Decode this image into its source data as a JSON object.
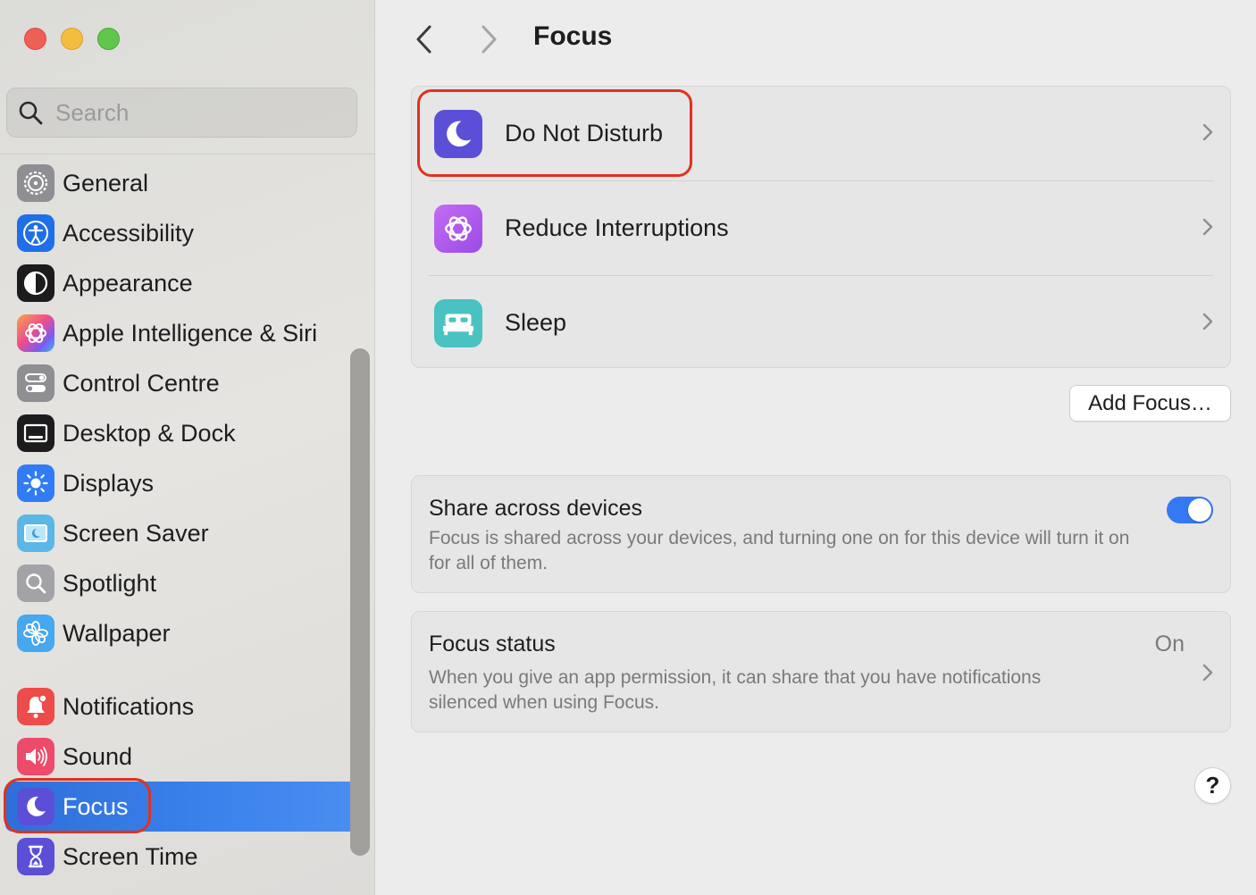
{
  "window": {
    "title": "Focus",
    "traffic_lights": [
      "close",
      "minimize",
      "maximize"
    ]
  },
  "sidebar": {
    "search": {
      "placeholder": "Search",
      "value": ""
    },
    "items": [
      {
        "label": "General",
        "icon": "gear-icon",
        "color": "#8e8e93"
      },
      {
        "label": "Accessibility",
        "icon": "accessibility-icon",
        "color": "#1f6fe8"
      },
      {
        "label": "Appearance",
        "icon": "appearance-icon",
        "color": "#1c1c1e"
      },
      {
        "label": "Apple Intelligence & Siri",
        "icon": "siri-icon",
        "color": "#f0f0f0"
      },
      {
        "label": "Control Centre",
        "icon": "control-centre-icon",
        "color": "#8e8e93"
      },
      {
        "label": "Desktop & Dock",
        "icon": "desktop-dock-icon",
        "color": "#1c1c1e"
      },
      {
        "label": "Displays",
        "icon": "displays-icon",
        "color": "#2f7cf6"
      },
      {
        "label": "Screen Saver",
        "icon": "screen-saver-icon",
        "color": "#5ab7e8"
      },
      {
        "label": "Spotlight",
        "icon": "spotlight-icon",
        "color": "#a2a2a7"
      },
      {
        "label": "Wallpaper",
        "icon": "wallpaper-icon",
        "color": "#47a7ef"
      },
      {
        "label": "Notifications",
        "icon": "notifications-icon",
        "color": "#ee4b4b"
      },
      {
        "label": "Sound",
        "icon": "sound-icon",
        "color": "#ee4b6a"
      },
      {
        "label": "Focus",
        "icon": "focus-moon-icon",
        "color": "#5b4fd8",
        "active": true
      },
      {
        "label": "Screen Time",
        "icon": "screen-time-icon",
        "color": "#5b4fd8"
      }
    ]
  },
  "main": {
    "title": "Focus",
    "focus_modes": [
      {
        "label": "Do Not Disturb",
        "icon": "moon-icon",
        "color": "#5b4fd8"
      },
      {
        "label": "Reduce Interruptions",
        "icon": "reduce-interruptions-icon",
        "color": "#b45bf0"
      },
      {
        "label": "Sleep",
        "icon": "bed-icon",
        "color": "#4ac2c2"
      }
    ],
    "add_focus_label": "Add Focus…",
    "share": {
      "title": "Share across devices",
      "description": "Focus is shared across your devices, and turning one on for this device will turn it on for all of them.",
      "enabled": true
    },
    "status": {
      "title": "Focus status",
      "value": "On",
      "description": "When you give an app permission, it can share that you have notifications silenced when using Focus."
    },
    "help_label": "?"
  },
  "colors": {
    "accent": "#3478f6",
    "selection": "#3b82ec",
    "highlight_annotation": "#e0321f"
  }
}
